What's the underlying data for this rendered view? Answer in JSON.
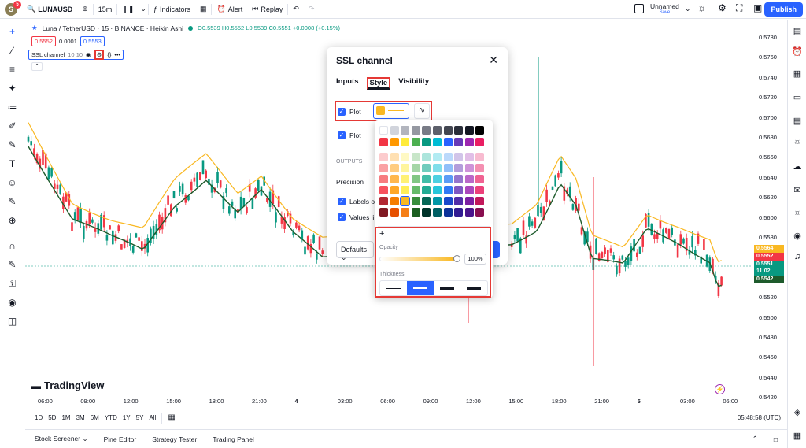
{
  "topbar": {
    "avatar_letter": "S",
    "badge_count": "5",
    "symbol": "LUNAUSD",
    "interval": "15m",
    "indicators_label": "Indicators",
    "alert_label": "Alert",
    "replay_label": "Replay",
    "layout_name": "Unnamed",
    "save_label": "Save",
    "publish_label": "Publish"
  },
  "legend": {
    "title": "Luna / TetherUSD · 15 · BINANCE · Heikin Ashi",
    "ohlc": "O0.5539 H0.5552 L0.5539 C0.5551 +0.0008 (+0.15%)",
    "bid": "0.5552",
    "spread": "0.0001",
    "ask": "0.5553",
    "indicator": "SSL channel",
    "indicator_params": "10 10"
  },
  "dialog": {
    "title": "SSL channel",
    "tabs": [
      "Inputs",
      "Style",
      "Visibility"
    ],
    "plot1_label": "Plot",
    "plot2_label": "Plot",
    "outputs_label": "OUTPUTS",
    "precision_label": "Precision",
    "labels_label": "Labels o",
    "values_label": "Values li",
    "defaults_label": "Defaults",
    "opacity_label": "Opacity",
    "opacity_value": "100%",
    "thickness_label": "Thickness",
    "plot1_color": "#f9b822"
  },
  "price_axis": [
    "0.5780",
    "0.5760",
    "0.5740",
    "0.5720",
    "0.5700",
    "0.5680",
    "0.5660",
    "0.5640",
    "0.5620",
    "0.5600",
    "0.5580",
    "0.5560",
    "0.5540",
    "0.5520",
    "0.5500",
    "0.5480",
    "0.5460",
    "0.5440",
    "0.5420"
  ],
  "price_tags": [
    {
      "value": "0.5564",
      "color": "#f9b822"
    },
    {
      "value": "0.5552",
      "color": "#f23645"
    },
    {
      "value": "0.5551",
      "color": "#089981"
    },
    {
      "value": "11:02",
      "color": "#089981"
    },
    {
      "value": "0.5542",
      "color": "#1e5b2c"
    }
  ],
  "time_axis": [
    "06:00",
    "09:00",
    "12:00",
    "15:00",
    "18:00",
    "21:00",
    "4",
    "03:00",
    "06:00",
    "09:00",
    "12:00",
    "15:00",
    "18:00",
    "21:00",
    "5",
    "03:00",
    "06:00"
  ],
  "ranges": [
    "1D",
    "5D",
    "1M",
    "3M",
    "6M",
    "YTD",
    "1Y",
    "5Y",
    "All"
  ],
  "clock": "05:48:58 (UTC)",
  "footer_tabs": [
    "Stock Screener",
    "Pine Editor",
    "Strategy Tester",
    "Trading Panel"
  ],
  "brand": "TradingView",
  "chart_colors": {
    "up": "#089981",
    "down": "#f23645",
    "ssl_up": "#f9b822",
    "ssl_down": "#1e5b2c"
  }
}
